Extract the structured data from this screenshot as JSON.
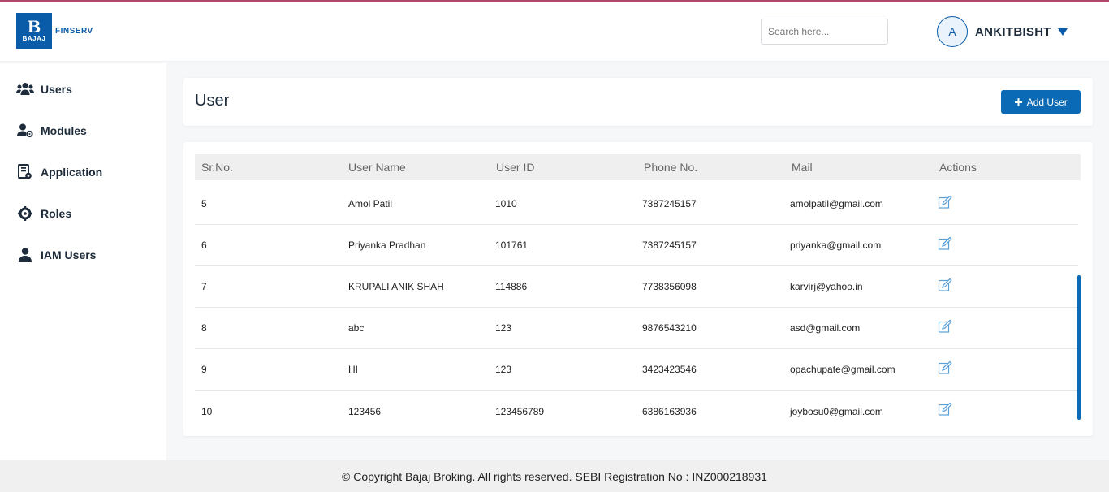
{
  "brand": {
    "logo_letter": "B",
    "logo_name": "BAJAJ",
    "logo_suffix": "FINSERV",
    "color": "#0a5ca8"
  },
  "header": {
    "search_placeholder": "Search here...",
    "avatar_initial": "A",
    "username": "ANKITBISHT"
  },
  "sidebar": {
    "items": [
      {
        "label": "Users",
        "icon": "users-icon"
      },
      {
        "label": "Modules",
        "icon": "user-cog-icon"
      },
      {
        "label": "Application",
        "icon": "application-icon"
      },
      {
        "label": "Roles",
        "icon": "gear-icon"
      },
      {
        "label": "IAM Users",
        "icon": "user-icon"
      }
    ]
  },
  "page": {
    "title": "User",
    "add_button_label": "Add User"
  },
  "table": {
    "columns": [
      "Sr.No.",
      "User Name",
      "User ID",
      "Phone No.",
      "Mail",
      "Actions"
    ],
    "rows": [
      {
        "sr": "5",
        "name": "Amol Patil",
        "user_id": "1010",
        "phone": "7387245157",
        "mail": "amolpatil@gmail.com"
      },
      {
        "sr": "6",
        "name": "Priyanka Pradhan",
        "user_id": "101761",
        "phone": "7387245157",
        "mail": "priyanka@gmail.com"
      },
      {
        "sr": "7",
        "name": "KRUPALI ANIK SHAH",
        "user_id": "114886",
        "phone": "7738356098",
        "mail": "karvirj@yahoo.in"
      },
      {
        "sr": "8",
        "name": "abc",
        "user_id": "123",
        "phone": "9876543210",
        "mail": "asd@gmail.com"
      },
      {
        "sr": "9",
        "name": "HI",
        "user_id": "123",
        "phone": "3423423546",
        "mail": "opachupate@gmail.com"
      },
      {
        "sr": "10",
        "name": "123456",
        "user_id": "123456789",
        "phone": "6386163936",
        "mail": "joybosu0@gmail.com"
      }
    ],
    "action_icon": "edit-icon"
  },
  "footer": {
    "text": "© Copyright Bajaj Broking. All rights reserved. SEBI Registration No : INZ000218931"
  }
}
